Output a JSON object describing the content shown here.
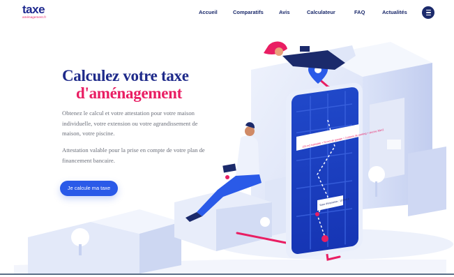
{
  "logo": {
    "main": "taxe",
    "sub": "aménagement.fr"
  },
  "nav": {
    "items": [
      {
        "label": "Accueil"
      },
      {
        "label": "Comparatifs"
      },
      {
        "label": "Avis"
      },
      {
        "label": "Calculateur"
      },
      {
        "label": "FAQ"
      },
      {
        "label": "Actualités"
      }
    ],
    "menu_icon": "hamburger-icon"
  },
  "hero": {
    "title_line1": "Calculez votre taxe",
    "title_line2": "d'aménagement",
    "paragraph1": "Obtenez le calcul et votre attestation pour votre maison individuelle, votre extension ou votre agrandissement de maison, votre piscine.",
    "paragraph2": "Attestation valable pour la prise en compte de votre plan de financement bancaire.",
    "cta_label": "Je calcule ma taxe"
  },
  "phone": {
    "card1": "150 m2 habitable + 54 m2 de garage + 3 places de parking + piscine 36m2",
    "card2": "Base d'imposition : 110000 €"
  },
  "colors": {
    "primary_blue": "#1e2a8a",
    "accent_pink": "#e91e63",
    "button_blue": "#2a5ae8"
  }
}
